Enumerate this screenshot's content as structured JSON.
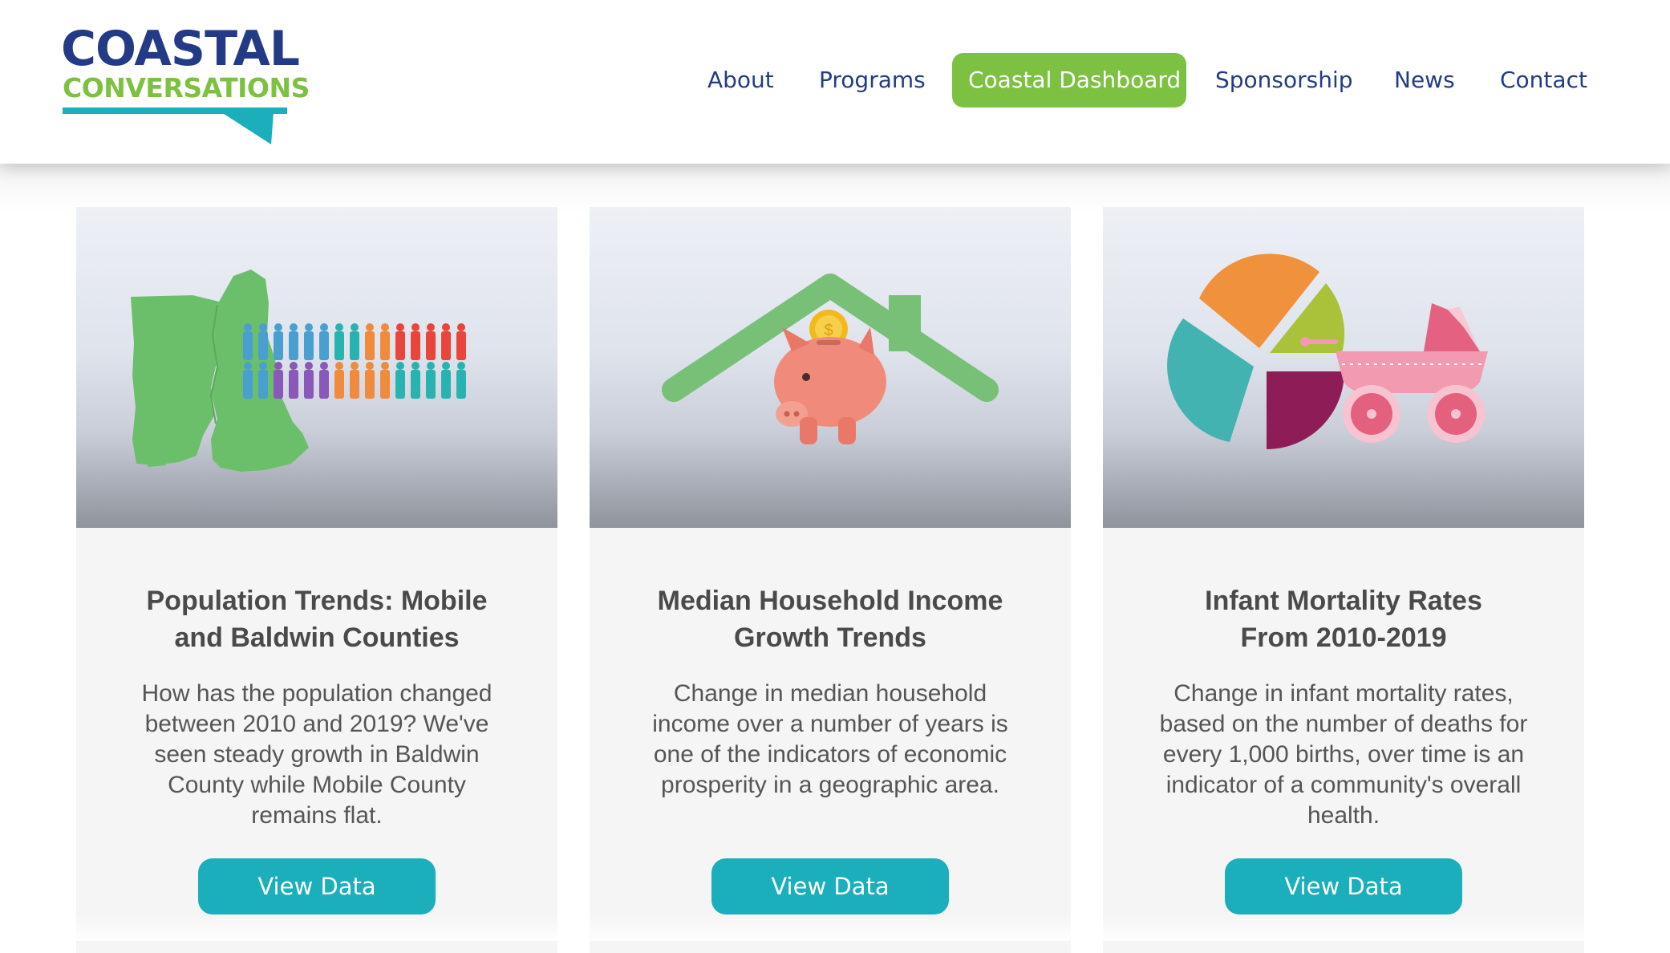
{
  "header": {
    "logo": {
      "line1": "COASTAL",
      "line2": "CONVERSATIONS"
    },
    "nav": [
      {
        "label": "About"
      },
      {
        "label": "Programs"
      },
      {
        "label": "Coastal Dashboard",
        "active": true
      },
      {
        "label": "Sponsorship"
      },
      {
        "label": "News"
      },
      {
        "label": "Contact"
      }
    ]
  },
  "cards": [
    {
      "title_line1": "Population Trends: Mobile",
      "title_line2": "and Baldwin Counties",
      "description": "How has the population changed between 2010 and 2019? We've seen steady growth in Baldwin County while Mobile County remains flat.",
      "button": "View Data",
      "image_icon": "map-population-illustration"
    },
    {
      "title_line1": "Median Household Income",
      "title_line2": "Growth Trends",
      "description": "Change in median household income over a number of years is one of the indicators of economic prosperity in a geographic area.",
      "button": "View Data",
      "image_icon": "piggy-bank-house-illustration"
    },
    {
      "title_line1": "Infant Mortality Rates",
      "title_line2": "From 2010-2019",
      "description": "Change in infant mortality rates, based on the number of deaths for every 1,000 births, over time is an indicator of a community's overall health.",
      "button": "View Data",
      "image_icon": "pie-chart-stroller-illustration"
    }
  ],
  "colors": {
    "navy": "#233b86",
    "green": "#7dc142",
    "teal": "#1aafbb",
    "title_text": "#4a4a4a",
    "body_text": "#555555"
  }
}
